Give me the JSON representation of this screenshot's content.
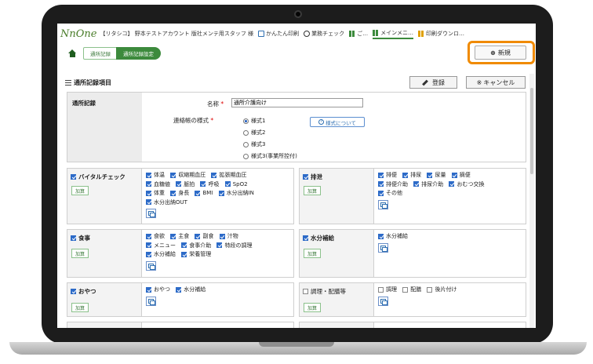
{
  "header": {
    "logo": "NnOne",
    "company": "【リタシコ】 野本テストアカウント 版社メンテ用スタッフ 様",
    "links": [
      {
        "label": "かんたん印刷",
        "icon": "print-icon"
      },
      {
        "label": "業務チェック",
        "icon": "info-icon"
      },
      {
        "label": "ご…",
        "icon": "grid-icon"
      },
      {
        "label": "メインメニ…",
        "icon": "grid-icon"
      },
      {
        "label": "印刷ダウンロ…",
        "icon": "grid-icon"
      }
    ]
  },
  "breadcrumb": {
    "items": [
      "通所記録",
      "通所記録設定"
    ]
  },
  "new_button": "新規",
  "section": {
    "title": "通所記録項目",
    "register": "登録",
    "cancel": "キャンセル"
  },
  "form": {
    "group_label": "通所記録",
    "name_label": "名称",
    "name_value": "通所介護向け",
    "format_label": "連絡帳の様式",
    "formats": [
      "様式1",
      "様式2",
      "様式3",
      "様式3(事業所控付)"
    ],
    "selected_format": "様式1",
    "about_button": "様式について",
    "required_mark": "*"
  },
  "calc_label": "加算",
  "cells": [
    {
      "title": "バイタルチェック",
      "checked": true,
      "items": [
        "体温",
        "収縮期血圧",
        "拡張期血圧",
        "血糖値",
        "脈拍",
        "呼吸",
        "SpO2",
        "体重",
        "身長",
        "BMI",
        "水分出納IN",
        "水分出納OUT"
      ]
    },
    {
      "title": "排泄",
      "checked": true,
      "items": [
        "排便",
        "排尿",
        "尿量",
        "摘便",
        "排便介助",
        "排尿介助",
        "おむつ交換",
        "その他"
      ]
    },
    {
      "title": "食事",
      "checked": true,
      "items": [
        "食欲",
        "主食",
        "副食",
        "汁物",
        "メニュー",
        "食事介助",
        "特段の調理",
        "水分補給",
        "栄養管理"
      ]
    },
    {
      "title": "水分補給",
      "checked": true,
      "items": [
        "水分補給"
      ]
    },
    {
      "title": "おやつ",
      "checked": true,
      "items": [
        "おやつ",
        "水分補給"
      ]
    },
    {
      "title": "調理・配膳等",
      "checked": false,
      "items": [
        "調理",
        "配膳",
        "後片付け"
      ]
    }
  ]
}
